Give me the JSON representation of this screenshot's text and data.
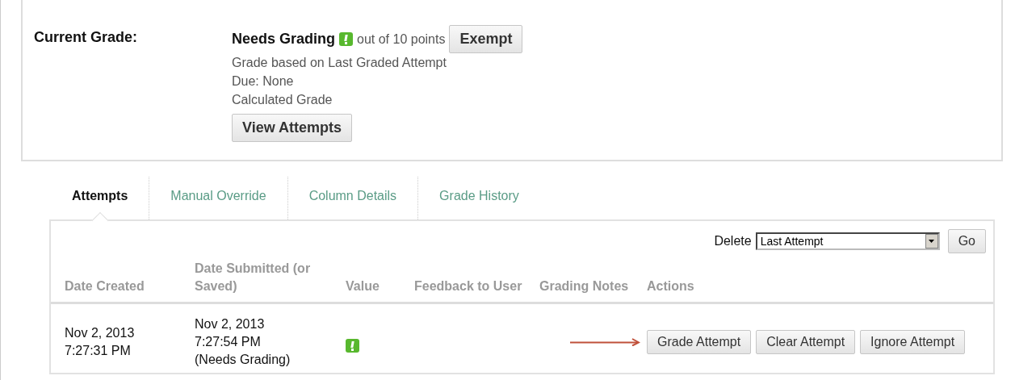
{
  "current_grade": {
    "label": "Current Grade:",
    "status": "Needs Grading",
    "needs_grading": true,
    "points": "out of 10 points",
    "exempt_button": "Exempt",
    "details": [
      "Grade based on Last Graded Attempt",
      "Due: None",
      "Calculated Grade"
    ],
    "view_button": "View Attempts"
  },
  "tabs": [
    {
      "label": "Attempts",
      "selected": true
    },
    {
      "label": "Manual Override",
      "selected": false
    },
    {
      "label": "Column Details",
      "selected": false
    },
    {
      "label": "Grade History",
      "selected": false
    }
  ],
  "delete": {
    "label": "Delete",
    "value": "Last Attempt",
    "go_button": "Go"
  },
  "table": {
    "columns": [
      "Date Created",
      "Date Submitted (or Saved)",
      "Value",
      "Feedback to User",
      "Grading Notes",
      "Actions"
    ],
    "rows": [
      {
        "date_created": [
          "Nov 2, 2013",
          "7:27:31 PM"
        ],
        "date_submitted": [
          "Nov 2, 2013",
          "7:27:54 PM",
          "(Needs Grading)"
        ],
        "needs_grading": true,
        "actions": [
          "Grade Attempt",
          "Clear Attempt",
          "Ignore Attempt"
        ]
      }
    ]
  }
}
